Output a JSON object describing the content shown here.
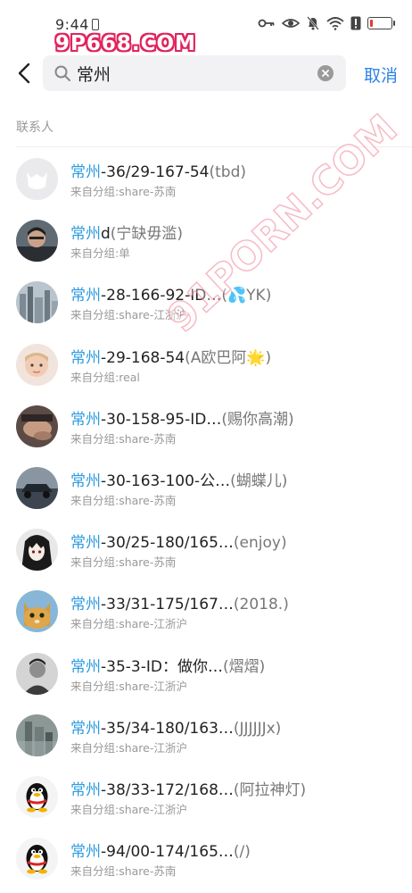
{
  "status_bar": {
    "time": "9:44"
  },
  "watermark": {
    "top": "9P668.COM",
    "diagonal": "91PORN.COM"
  },
  "search": {
    "query": "常州",
    "cancel_label": "取消"
  },
  "section": {
    "label": "联系人"
  },
  "contacts": [
    {
      "highlight": "常州",
      "name": "-36/29-167-54",
      "note": "(tbd)",
      "group": "来自分组:share-苏南",
      "avatar": "default"
    },
    {
      "highlight": "常州",
      "name": "d",
      "note": "(宁缺毋滥)",
      "group": "来自分组:单",
      "avatar": "person"
    },
    {
      "highlight": "常州",
      "name": "-28-166-92-ID…",
      "note": "(💦YK)",
      "group": "来自分组:share-江浙沪",
      "avatar": "city"
    },
    {
      "highlight": "常州",
      "name": "-29-168-54",
      "note": "(A欧巴阿🌟)",
      "group": "来自分组:real",
      "avatar": "child"
    },
    {
      "highlight": "常州",
      "name": "-30-158-95-ID…",
      "note": "(赐你高潮)",
      "group": "来自分组:share-苏南",
      "avatar": "hand"
    },
    {
      "highlight": "常州",
      "name": "-30-163-100-公…",
      "note": "(蝴蝶儿)",
      "group": "来自分组:share-苏南",
      "avatar": "car"
    },
    {
      "highlight": "常州",
      "name": "-30/25-180/165…",
      "note": "(enjoy)",
      "group": "来自分组:share-苏南",
      "avatar": "anime"
    },
    {
      "highlight": "常州",
      "name": "-33/31-175/167…",
      "note": "(2018.)",
      "group": "来自分组:share-江浙沪",
      "avatar": "cat"
    },
    {
      "highlight": "常州",
      "name": "-35-3-ID：做你…",
      "note": "(熠熠)",
      "group": "来自分组:share-江浙沪",
      "avatar": "mono"
    },
    {
      "highlight": "常州",
      "name": "-35/34-180/163…",
      "note": "(JJJJJJx)",
      "group": "来自分组:share-江浙沪",
      "avatar": "misty"
    },
    {
      "highlight": "常州",
      "name": "-38/33-172/168…",
      "note": "(阿拉神灯)",
      "group": "来自分组:share-江浙沪",
      "avatar": "penguin"
    },
    {
      "highlight": "常州",
      "name": "-94/00-174/165…",
      "note": "(/)",
      "group": "来自分组:share-苏南",
      "avatar": "penguin"
    }
  ],
  "colors": {
    "accent": "#2d83e6",
    "highlight": "#2d9be0",
    "battery_low": "#e53935"
  },
  "battery_level": 0.15
}
